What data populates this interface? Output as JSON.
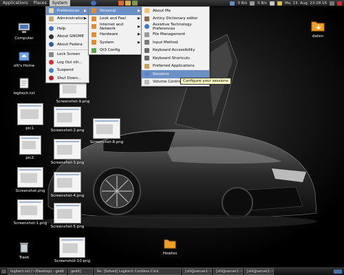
{
  "top_panel": {
    "menus": [
      "Applications",
      "Places",
      "System"
    ],
    "tray": {
      "net_down": "0 B/s",
      "net_up": "0 B/s",
      "clock": "Mo, 13. Aug, 23:28:16"
    }
  },
  "system_menu": {
    "items": [
      {
        "label": "Preferences",
        "submenu": true
      },
      {
        "label": "Administration",
        "submenu": true
      },
      {
        "label": "Help"
      },
      {
        "label": "About GNOME"
      },
      {
        "label": "About Fedora"
      },
      {
        "label": "Lock Screen"
      },
      {
        "label": "Log Out olli..."
      },
      {
        "label": "Suspend"
      },
      {
        "label": "Shut Down..."
      }
    ]
  },
  "preferences_menu": {
    "items": [
      {
        "label": "Personal",
        "submenu": true
      },
      {
        "label": "Look and Feel",
        "submenu": true
      },
      {
        "label": "Internet and Network",
        "submenu": true
      },
      {
        "label": "Hardware",
        "submenu": true
      },
      {
        "label": "System",
        "submenu": true
      },
      {
        "label": "Qt3 Config"
      }
    ]
  },
  "personal_menu": {
    "items": [
      {
        "label": "About Me"
      },
      {
        "label": "Antiny Dictionary editor"
      },
      {
        "label": "Assistive Technology Preferences"
      },
      {
        "label": "File Management"
      },
      {
        "label": "Input Method"
      },
      {
        "label": "Keyboard Accessibility"
      },
      {
        "label": "Keyboard Shortcuts"
      },
      {
        "label": "Preferred Applications"
      },
      {
        "label": "Sessions"
      },
      {
        "label": "Volume Control"
      }
    ]
  },
  "tooltip": "Configure your sessions",
  "desktop": {
    "computer": "Computer",
    "home": "olli's Home",
    "logitech": "logitech.txt",
    "daten": "daten",
    "trash": "Trash",
    "howtos": "Howtos",
    "pic1": "pic1.",
    "pic2": "pic2.",
    "shots": [
      "Screenshot-9.png",
      "Screenshot-2.png",
      "Screenshot-8.png",
      "Screenshot-3.png",
      "Screenshot.png",
      "Screenshot-4.png",
      "Screenshot-1.png",
      "Screenshot-5.png",
      "Screenshot-10.png"
    ]
  },
  "taskbar": [
    "logitech.txt (~/Desktop) - gedit",
    "gedit]",
    "Re: [Solved] Logitech Cordless Click",
    "[olli@server1:~]",
    "[olli@server1:~]",
    "[olli@server1:~]"
  ],
  "colors": {
    "highlight": "#6b90c6",
    "menu_bg": "#f1f1f1",
    "panel": "#2a2a2a",
    "folder": "#f0a020"
  }
}
